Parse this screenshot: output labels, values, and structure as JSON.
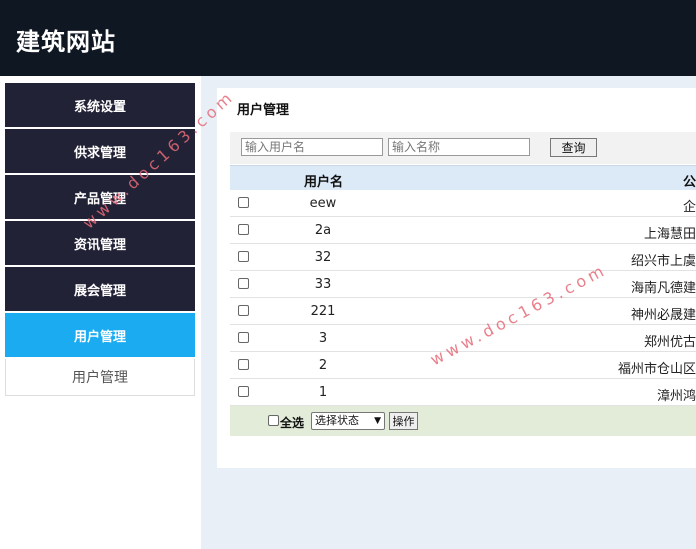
{
  "header": {
    "site_title": "建筑网站"
  },
  "sidebar": {
    "items": [
      {
        "label": "系统设置"
      },
      {
        "label": "供求管理"
      },
      {
        "label": "产品管理"
      },
      {
        "label": "资讯管理"
      },
      {
        "label": "展会管理"
      },
      {
        "label": "用户管理",
        "active": true
      }
    ],
    "submenu": [
      {
        "label": "用户管理"
      }
    ]
  },
  "main": {
    "title": "用户管理",
    "search": {
      "username_placeholder": "输入用户名",
      "name_placeholder": "输入名称",
      "button_label": "查询"
    },
    "table": {
      "columns": [
        "用户名",
        "公"
      ],
      "rows": [
        {
          "username": "eew",
          "company": "企"
        },
        {
          "username": "2a",
          "company": "上海慧田"
        },
        {
          "username": "32",
          "company": "绍兴市上虞"
        },
        {
          "username": "33",
          "company": "海南凡德建"
        },
        {
          "username": "221",
          "company": "神州必晟建"
        },
        {
          "username": "3",
          "company": "郑州优古"
        },
        {
          "username": "2",
          "company": "福州市仓山区"
        },
        {
          "username": "1",
          "company": "漳州鸿"
        }
      ]
    },
    "footer": {
      "select_all_label": "全选",
      "status_select": "选择状态",
      "action_button": "操作"
    }
  },
  "watermark": {
    "text": "www.doc163.com"
  },
  "colors": {
    "header_bg": "#0f1722",
    "menu_bg": "#222236",
    "menu_active": "#1aabf0"
  }
}
